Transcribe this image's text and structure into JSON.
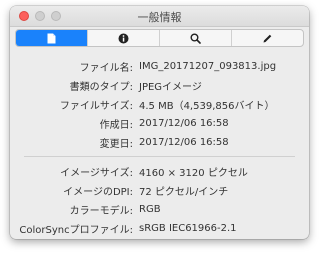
{
  "window": {
    "title": "一般情報"
  },
  "tabs": [
    {
      "icon": "document-icon",
      "active": true
    },
    {
      "icon": "info-icon",
      "active": false
    },
    {
      "icon": "search-icon",
      "active": false
    },
    {
      "icon": "pencil-icon",
      "active": false
    }
  ],
  "file_info": [
    {
      "label": "ファイル名:",
      "value": "IMG_20171207_093813.jpg"
    },
    {
      "label": "書類のタイプ:",
      "value": "JPEGイメージ"
    },
    {
      "label": "ファイルサイズ:",
      "value": "4.5 MB（4,539,856バイト）"
    },
    {
      "label": "作成日:",
      "value": "2017/12/06 16:58"
    },
    {
      "label": "変更日:",
      "value": "2017/12/06 16:58"
    }
  ],
  "image_info": [
    {
      "label": "イメージサイズ:",
      "value": "4160 × 3120 ピクセル"
    },
    {
      "label": "イメージのDPI:",
      "value": "72 ピクセル/インチ"
    },
    {
      "label": "カラーモデル:",
      "value": "RGB"
    },
    {
      "label": "ColorSyncプロファイル:",
      "value": "sRGB IEC61966-2.1"
    }
  ],
  "colors": {
    "accent": "#1a82fb",
    "close": "#fc605c"
  }
}
